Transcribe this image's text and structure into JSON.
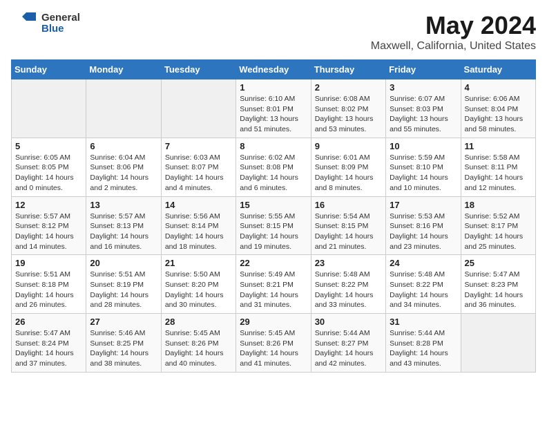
{
  "header": {
    "logo_general": "General",
    "logo_blue": "Blue",
    "month": "May 2024",
    "location": "Maxwell, California, United States"
  },
  "days_of_week": [
    "Sunday",
    "Monday",
    "Tuesday",
    "Wednesday",
    "Thursday",
    "Friday",
    "Saturday"
  ],
  "weeks": [
    [
      {
        "day": "",
        "info": ""
      },
      {
        "day": "",
        "info": ""
      },
      {
        "day": "",
        "info": ""
      },
      {
        "day": "1",
        "info": "Sunrise: 6:10 AM\nSunset: 8:01 PM\nDaylight: 13 hours\nand 51 minutes."
      },
      {
        "day": "2",
        "info": "Sunrise: 6:08 AM\nSunset: 8:02 PM\nDaylight: 13 hours\nand 53 minutes."
      },
      {
        "day": "3",
        "info": "Sunrise: 6:07 AM\nSunset: 8:03 PM\nDaylight: 13 hours\nand 55 minutes."
      },
      {
        "day": "4",
        "info": "Sunrise: 6:06 AM\nSunset: 8:04 PM\nDaylight: 13 hours\nand 58 minutes."
      }
    ],
    [
      {
        "day": "5",
        "info": "Sunrise: 6:05 AM\nSunset: 8:05 PM\nDaylight: 14 hours\nand 0 minutes."
      },
      {
        "day": "6",
        "info": "Sunrise: 6:04 AM\nSunset: 8:06 PM\nDaylight: 14 hours\nand 2 minutes."
      },
      {
        "day": "7",
        "info": "Sunrise: 6:03 AM\nSunset: 8:07 PM\nDaylight: 14 hours\nand 4 minutes."
      },
      {
        "day": "8",
        "info": "Sunrise: 6:02 AM\nSunset: 8:08 PM\nDaylight: 14 hours\nand 6 minutes."
      },
      {
        "day": "9",
        "info": "Sunrise: 6:01 AM\nSunset: 8:09 PM\nDaylight: 14 hours\nand 8 minutes."
      },
      {
        "day": "10",
        "info": "Sunrise: 5:59 AM\nSunset: 8:10 PM\nDaylight: 14 hours\nand 10 minutes."
      },
      {
        "day": "11",
        "info": "Sunrise: 5:58 AM\nSunset: 8:11 PM\nDaylight: 14 hours\nand 12 minutes."
      }
    ],
    [
      {
        "day": "12",
        "info": "Sunrise: 5:57 AM\nSunset: 8:12 PM\nDaylight: 14 hours\nand 14 minutes."
      },
      {
        "day": "13",
        "info": "Sunrise: 5:57 AM\nSunset: 8:13 PM\nDaylight: 14 hours\nand 16 minutes."
      },
      {
        "day": "14",
        "info": "Sunrise: 5:56 AM\nSunset: 8:14 PM\nDaylight: 14 hours\nand 18 minutes."
      },
      {
        "day": "15",
        "info": "Sunrise: 5:55 AM\nSunset: 8:15 PM\nDaylight: 14 hours\nand 19 minutes."
      },
      {
        "day": "16",
        "info": "Sunrise: 5:54 AM\nSunset: 8:15 PM\nDaylight: 14 hours\nand 21 minutes."
      },
      {
        "day": "17",
        "info": "Sunrise: 5:53 AM\nSunset: 8:16 PM\nDaylight: 14 hours\nand 23 minutes."
      },
      {
        "day": "18",
        "info": "Sunrise: 5:52 AM\nSunset: 8:17 PM\nDaylight: 14 hours\nand 25 minutes."
      }
    ],
    [
      {
        "day": "19",
        "info": "Sunrise: 5:51 AM\nSunset: 8:18 PM\nDaylight: 14 hours\nand 26 minutes."
      },
      {
        "day": "20",
        "info": "Sunrise: 5:51 AM\nSunset: 8:19 PM\nDaylight: 14 hours\nand 28 minutes."
      },
      {
        "day": "21",
        "info": "Sunrise: 5:50 AM\nSunset: 8:20 PM\nDaylight: 14 hours\nand 30 minutes."
      },
      {
        "day": "22",
        "info": "Sunrise: 5:49 AM\nSunset: 8:21 PM\nDaylight: 14 hours\nand 31 minutes."
      },
      {
        "day": "23",
        "info": "Sunrise: 5:48 AM\nSunset: 8:22 PM\nDaylight: 14 hours\nand 33 minutes."
      },
      {
        "day": "24",
        "info": "Sunrise: 5:48 AM\nSunset: 8:22 PM\nDaylight: 14 hours\nand 34 minutes."
      },
      {
        "day": "25",
        "info": "Sunrise: 5:47 AM\nSunset: 8:23 PM\nDaylight: 14 hours\nand 36 minutes."
      }
    ],
    [
      {
        "day": "26",
        "info": "Sunrise: 5:47 AM\nSunset: 8:24 PM\nDaylight: 14 hours\nand 37 minutes."
      },
      {
        "day": "27",
        "info": "Sunrise: 5:46 AM\nSunset: 8:25 PM\nDaylight: 14 hours\nand 38 minutes."
      },
      {
        "day": "28",
        "info": "Sunrise: 5:45 AM\nSunset: 8:26 PM\nDaylight: 14 hours\nand 40 minutes."
      },
      {
        "day": "29",
        "info": "Sunrise: 5:45 AM\nSunset: 8:26 PM\nDaylight: 14 hours\nand 41 minutes."
      },
      {
        "day": "30",
        "info": "Sunrise: 5:44 AM\nSunset: 8:27 PM\nDaylight: 14 hours\nand 42 minutes."
      },
      {
        "day": "31",
        "info": "Sunrise: 5:44 AM\nSunset: 8:28 PM\nDaylight: 14 hours\nand 43 minutes."
      },
      {
        "day": "",
        "info": ""
      }
    ]
  ]
}
